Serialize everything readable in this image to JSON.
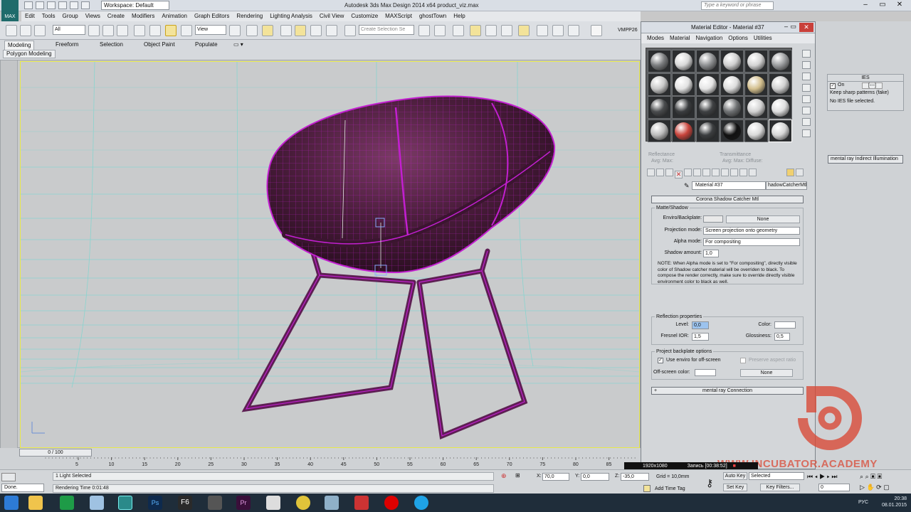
{
  "titlebar": {
    "workspace": "Workspace: Default",
    "app_title": "Autodesk 3ds Max Design 2014 x64      product_viz.max",
    "search_placeholder": "Type a keyword or phrase",
    "logo": "MAX"
  },
  "menu": [
    "Edit",
    "Tools",
    "Group",
    "Views",
    "Create",
    "Modifiers",
    "Animation",
    "Graph Editors",
    "Rendering",
    "Lighting Analysis",
    "Civil View",
    "Customize",
    "MAXScript",
    "ghostTown",
    "Help"
  ],
  "toolbar": {
    "filter_combo": "All",
    "view_combo": "View",
    "selection_set": "Create Selection Se",
    "vmp": "VMPP26"
  },
  "ribbon": {
    "tabs": [
      "Modeling",
      "Freeform",
      "Selection",
      "Object Paint",
      "Populate"
    ],
    "subpanel": "Polygon Modeling"
  },
  "timeline": {
    "slider_label": "0 / 100",
    "ticks": [
      "5",
      "10",
      "15",
      "20",
      "25",
      "30",
      "35",
      "40",
      "45",
      "50",
      "55",
      "60",
      "65",
      "70",
      "75",
      "80",
      "85"
    ]
  },
  "status": {
    "command": "Done.",
    "selection_info": "1 Light Selected",
    "render_time": "Rendering Time  0:01:48",
    "x_label": "X:",
    "x_value": "70,0",
    "y_label": "Y:",
    "y_value": "0,0",
    "z_label": "Z:",
    "z_value": "-35,0",
    "grid": "Grid = 10,0mm",
    "add_time_tag": "Add Time Tag",
    "auto_key": "Auto Key",
    "auto_key_mode": "Selected",
    "set_key": "Set Key",
    "key_filters": "Key Filters...",
    "frame": "0"
  },
  "recording": {
    "resolution": "1920x1080",
    "label": "Запись [00:38:52]"
  },
  "taskbar": {
    "lang": "РУС",
    "time": "20:38",
    "date": "08.01.2015"
  },
  "command_panel": {
    "ies_title": "IES",
    "on_label": "On",
    "on_value": "[---]",
    "keep_sharp": "Keep sharp patterns (fake)",
    "no_ies": "No IES file selected.",
    "mr_indirect": "mental ray Indirect Illumination"
  },
  "material_editor": {
    "title": "Material Editor - Material #37",
    "menu": [
      "Modes",
      "Material",
      "Navigation",
      "Options",
      "Utilities"
    ],
    "reflectance_label": "Reflectance",
    "reflectance_sub": "Avg:    Max:",
    "transmittance_label": "Transmittance",
    "transmittance_sub": "Avg:    Max:     Diffuse:",
    "material_name": "Material #37",
    "material_type": "hadowCatcherMtl",
    "rollout_title": "Corona Shadow Catcher Mtl",
    "matte_group": "Matte/Shadow",
    "enviro_label": "Enviro/Backplate:",
    "enviro_map": "None",
    "projection_label": "Projection mode:",
    "projection_value": "Screen projection onto geometry",
    "alpha_label": "Alpha mode:",
    "alpha_value": "For compositing",
    "shadow_amount_label": "Shadow amount:",
    "shadow_amount_value": "1,0",
    "note": "NOTE: When Alpha mode is set to \"For compositing\", directly visible color of Shadow catcher material will be overriden to black. To compose the render correctly, make sure to override directly visible environment color to black as well.",
    "reflection_group": "Reflection properties",
    "level_label": "Level:",
    "level_value": "0,0",
    "color_label": "Color:",
    "fresnel_label": "Fresnel IOR:",
    "fresnel_value": "1,5",
    "glossiness_label": "Glossiness:",
    "glossiness_value": "0,5",
    "backplate_group": "Project backplate options",
    "use_enviro": "Use enviro for off-screen",
    "preserve_ratio": "Preserve aspect ratio",
    "offscreen_label": "Off-screen color:",
    "offscreen_map": "None",
    "mr_connection": "mental ray Connection",
    "slot_colors": [
      "#7a7c7e",
      "#d8d8d8",
      "#8d8f91",
      "#cfcfcf",
      "#d4d4d4",
      "#9a9c9e",
      "#c8c8c8",
      "#e2e2e2",
      "#e5e5e5",
      "#dcdcdc",
      "#d3bf8e",
      "#d0d0d0",
      "#4a4c4e",
      "#3a3c3e",
      "#3f4143",
      "#6e7072",
      "#d2d2d2",
      "#dedede",
      "#bcbcbc",
      "#c8443c",
      "#3c3e40",
      "#111111",
      "#dadada",
      "#d6d6d6"
    ]
  },
  "watermark": {
    "text": "WWW.INCUBATOR.ACADEMY",
    "color": "#d94834"
  },
  "colors": {
    "wireframe": "#c21fd0",
    "chair_body": "#5a2548",
    "grid_lines": "#7fd6d0"
  }
}
